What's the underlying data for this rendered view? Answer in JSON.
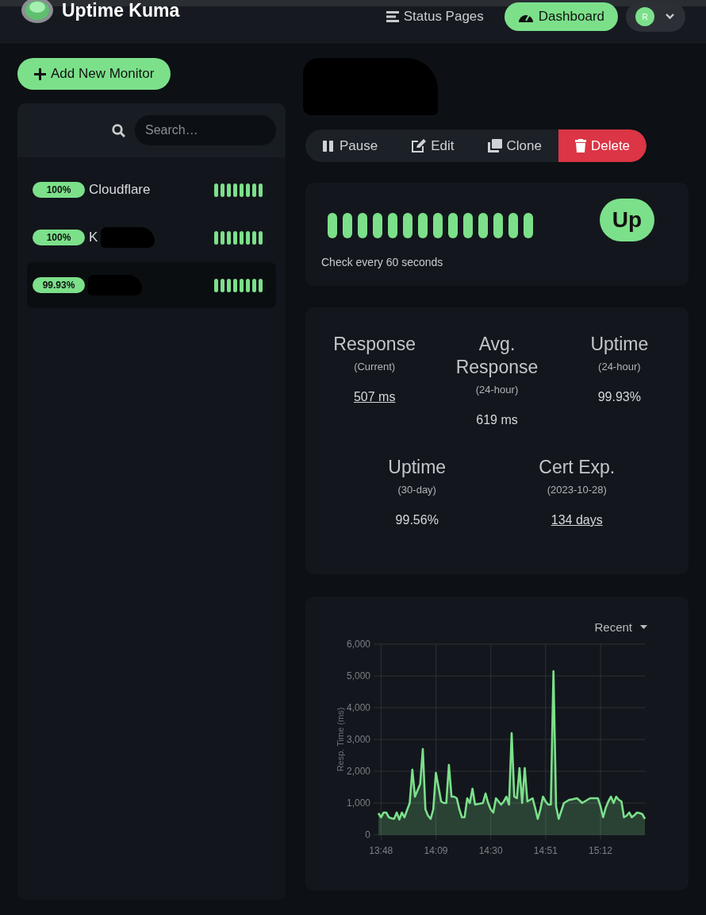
{
  "header": {
    "app_name": "Uptime Kuma",
    "nav": [
      {
        "label": "Status Pages",
        "kind": "link",
        "selected": false
      },
      {
        "label": "Dashboard",
        "kind": "pill",
        "selected": true
      }
    ],
    "avatar_initial": "R"
  },
  "add_button": "Add New Monitor",
  "search": {
    "placeholder": "Search…"
  },
  "monitors": [
    {
      "uptime": "100%",
      "name": "Cloudflare",
      "redacted": false,
      "selected": false,
      "beats": [
        {
          "color": "#7ce08a"
        },
        {
          "color": "#7ce08a"
        },
        {
          "color": "#7ce08a"
        },
        {
          "color": "#7ce08a"
        },
        {
          "color": "#7ce08a"
        },
        {
          "color": "#7ce08a"
        },
        {
          "color": "#7ce08a"
        },
        {
          "color": "#7ce08a"
        }
      ]
    },
    {
      "uptime": "100%",
      "name": "K",
      "redacted": true,
      "selected": false,
      "beats": [
        {
          "color": "#7ce08a"
        },
        {
          "color": "#7ce08a"
        },
        {
          "color": "#7ce08a"
        },
        {
          "color": "#7ce08a"
        },
        {
          "color": "#7ce08a"
        },
        {
          "color": "#7ce08a"
        },
        {
          "color": "#7ce08a"
        },
        {
          "color": "#7ce08a"
        }
      ]
    },
    {
      "uptime": "99.93%",
      "redacted": true,
      "selected": true,
      "beats": [
        {
          "color": "#7ce08a"
        },
        {
          "color": "#7ce08a"
        },
        {
          "color": "#7ce08a"
        },
        {
          "color": "#7ce08a"
        },
        {
          "color": "#7ce08a"
        },
        {
          "color": "#7ce08a"
        },
        {
          "color": "#7ce08a"
        },
        {
          "color": "#7ce08a"
        }
      ]
    }
  ],
  "actions": [
    {
      "label": "Pause",
      "kind": "pause"
    },
    {
      "label": "Edit",
      "kind": "edit"
    },
    {
      "label": "Clone",
      "kind": "clone"
    },
    {
      "label": "Delete",
      "kind": "delete"
    }
  ],
  "heartbeat": {
    "beats": [
      {
        "color": "#7ce08a"
      },
      {
        "color": "#7ce08a"
      },
      {
        "color": "#7ce08a"
      },
      {
        "color": "#7ce08a"
      },
      {
        "color": "#7ce08a"
      },
      {
        "color": "#7ce08a"
      },
      {
        "color": "#7ce08a"
      },
      {
        "color": "#7ce08a"
      },
      {
        "color": "#7ce08a"
      },
      {
        "color": "#7ce08a"
      },
      {
        "color": "#7ce08a"
      },
      {
        "color": "#7ce08a"
      },
      {
        "color": "#7ce08a"
      },
      {
        "color": "#7ce08a"
      }
    ],
    "status": "Up",
    "interval_text": "Check every 60 seconds"
  },
  "stats": [
    {
      "title": "Response",
      "period": "(Current)",
      "value": "507 ms",
      "link": true
    },
    {
      "title": "Avg. Response",
      "period": "(24-hour)",
      "value": "619 ms",
      "link": false
    },
    {
      "title": "Uptime",
      "period": "(24-hour)",
      "value": "99.93%",
      "link": false
    },
    {
      "title": "Uptime",
      "period": "(30-day)",
      "value": "99.56%",
      "link": false
    },
    {
      "title": "Cert Exp.",
      "period": "(2023-10-28)",
      "value": "134 days",
      "link": true
    }
  ],
  "chart": {
    "range": "Recent",
    "chart_data": {
      "type": "area",
      "grid": true,
      "ylabel": "Resp. Time (ms)",
      "categories": [
        null,
        "13:48",
        null,
        null,
        null,
        null,
        null,
        null,
        null,
        null,
        null,
        null,
        null,
        null,
        null,
        null,
        null,
        null,
        null,
        null,
        null,
        null,
        "14:09",
        null,
        null,
        null,
        null,
        null,
        null,
        null,
        null,
        null,
        null,
        null,
        null,
        null,
        null,
        null,
        null,
        null,
        null,
        null,
        null,
        "14:30",
        null,
        null,
        null,
        null,
        null,
        null,
        null,
        null,
        null,
        null,
        null,
        null,
        null,
        null,
        null,
        null,
        null,
        null,
        null,
        null,
        "14:51",
        null,
        null,
        null,
        null,
        null,
        null,
        null,
        null,
        null,
        null,
        null,
        null,
        null,
        null,
        null,
        null,
        null,
        null,
        null,
        null,
        "15:12",
        null,
        null,
        null,
        null,
        null,
        null,
        null,
        null,
        null,
        null,
        null,
        null,
        null,
        null,
        null,
        null,
        null
      ],
      "series": [
        {
          "color": "#7ce08a",
          "values": [
            680,
            550,
            700,
            700,
            550,
            520,
            500,
            700,
            480,
            700,
            550,
            780,
            1000,
            2050,
            1200,
            1400,
            1600,
            2700,
            800,
            600,
            500,
            800,
            1950,
            1500,
            1050,
            1000,
            1000,
            2200,
            1200,
            1200,
            1150,
            800,
            550,
            550,
            1150,
            1000,
            1450,
            950,
            970,
            980,
            1000,
            1300,
            1000,
            800,
            700,
            1150,
            1050,
            950,
            1050,
            1200,
            950,
            3200,
            1200,
            1150,
            2100,
            1000,
            2100,
            1050,
            1100,
            1150,
            850,
            500,
            800,
            1200,
            1050,
            950,
            950,
            5150,
            900,
            500,
            750,
            1000,
            1050,
            1100,
            1110,
            1130,
            1150,
            1080,
            1000,
            1050,
            1100,
            1150,
            1150,
            1150,
            1150,
            900,
            550,
            850,
            1050,
            1200,
            1000,
            1200,
            1100,
            1050,
            550,
            600,
            700,
            550,
            620,
            700,
            680,
            650,
            500
          ]
        }
      ],
      "ylim": [
        0,
        6000
      ],
      "yticks": [
        {
          "value": 0,
          "label": "0"
        },
        {
          "value": 1000,
          "label": "1,000"
        },
        {
          "value": 2000,
          "label": "2,000"
        },
        {
          "value": 3000,
          "label": "3,000"
        },
        {
          "value": 4000,
          "label": "4,000"
        },
        {
          "value": 5000,
          "label": "5,000"
        },
        {
          "value": 6000,
          "label": "6,000"
        }
      ]
    }
  }
}
